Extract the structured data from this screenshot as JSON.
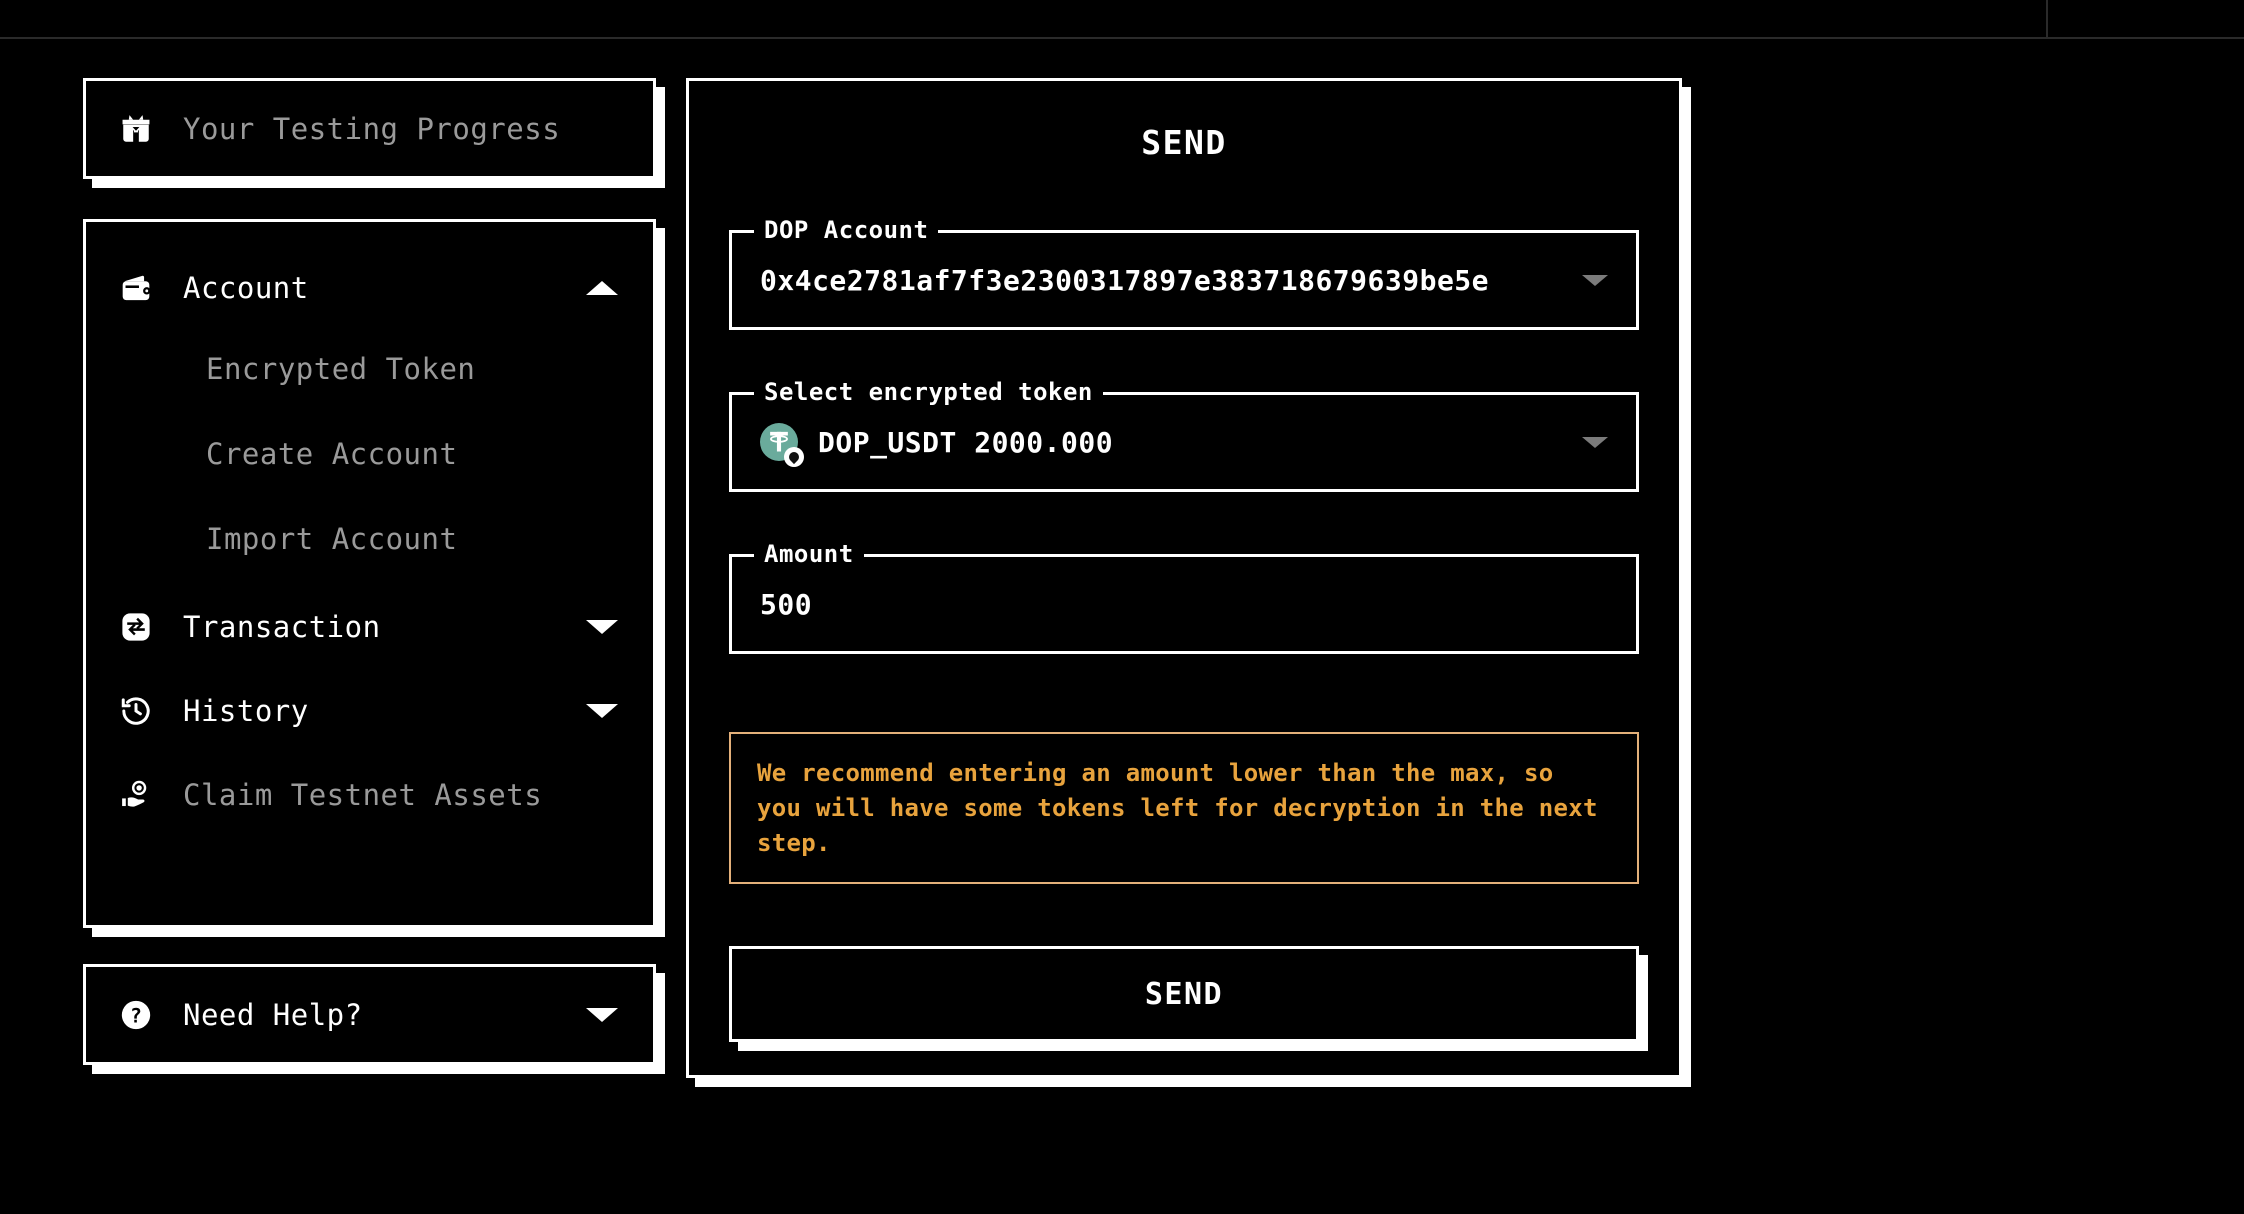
{
  "theme": {
    "background": "#000000",
    "foreground": "#ffffff",
    "muted": "#9a9a9a",
    "caret": "#7b7b7b",
    "warning_text": "#e8a33d",
    "warning_border": "#e3b07a",
    "token_coin": "#6aab9c",
    "topbar_line": "#2a2a2a"
  },
  "sidebar": {
    "progress": {
      "label": "Your Testing Progress",
      "icon": "gift-box-icon"
    },
    "nav": [
      {
        "label": "Account",
        "icon": "wallet-icon",
        "expanded": true,
        "caret": "caret-up-icon",
        "active": true,
        "children": [
          {
            "label": "Encrypted Token"
          },
          {
            "label": "Create Account"
          },
          {
            "label": "Import Account"
          }
        ]
      },
      {
        "label": "Transaction",
        "icon": "swap-icon",
        "expanded": false,
        "caret": "caret-down-icon",
        "active": true
      },
      {
        "label": "History",
        "icon": "clock-history-icon",
        "expanded": false,
        "caret": "caret-down-icon",
        "active": true
      },
      {
        "label": "Claim Testnet Assets",
        "icon": "hand-coin-icon",
        "expanded": false,
        "caret": "",
        "active": false
      }
    ],
    "help": {
      "label": "Need Help?",
      "icon": "question-circle-icon",
      "caret": "caret-down-icon"
    }
  },
  "main": {
    "title": "SEND",
    "fields": {
      "account": {
        "legend": "DOP Account",
        "value": "0x4ce2781af7f3e2300317897e383718679639be5e",
        "caret": "caret-down-icon"
      },
      "token": {
        "legend": "Select encrypted token",
        "symbol": "DOP_USDT",
        "balance": "2000.000",
        "value": "DOP_USDT 2000.000",
        "logo": "tether-usdt-icon",
        "logo_glyph": "₮",
        "caret": "caret-down-icon"
      },
      "amount": {
        "legend": "Amount",
        "value": "500",
        "placeholder": "Amount"
      }
    },
    "warning": "We recommend entering an amount lower than the max, so you will have some tokens left for decryption in the next step.",
    "submit_label": "SEND"
  }
}
